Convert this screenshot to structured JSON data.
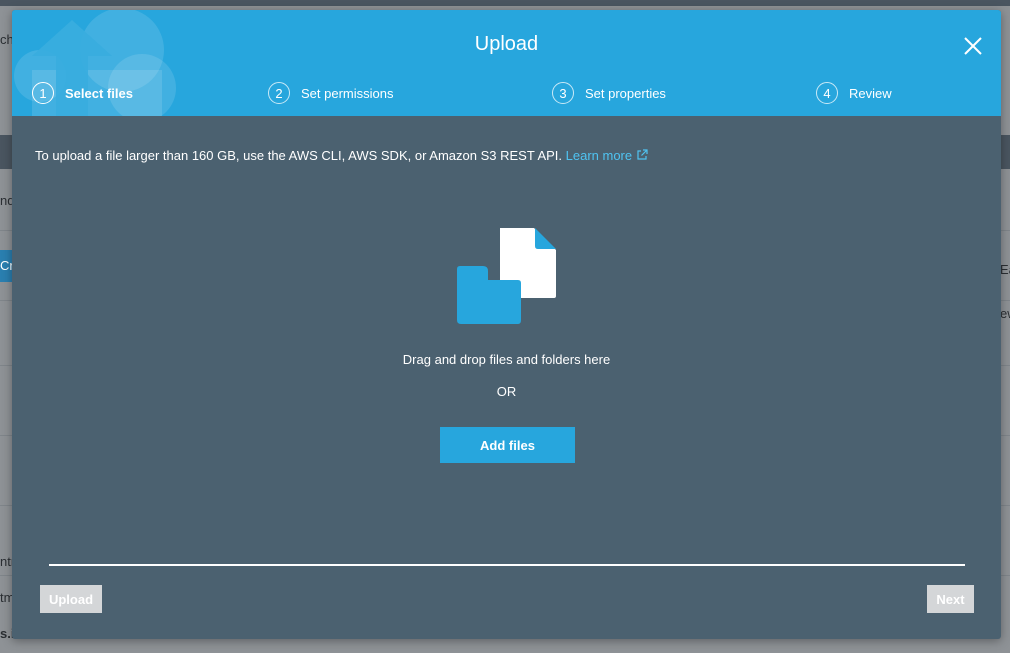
{
  "background": {
    "fragments": [
      "ch",
      "nd",
      "Cr",
      "Ea",
      "ew",
      "ntr",
      "tm",
      "s.i"
    ]
  },
  "modal": {
    "title": "Upload",
    "close_icon": "close-icon",
    "steps": [
      {
        "number": "1",
        "label": "Select files",
        "active": true
      },
      {
        "number": "2",
        "label": "Set permissions",
        "active": false
      },
      {
        "number": "3",
        "label": "Set properties",
        "active": false
      },
      {
        "number": "4",
        "label": "Review",
        "active": false
      }
    ],
    "info_text": "To upload a file larger than 160 GB, use the AWS CLI, AWS SDK, or Amazon S3 REST API.",
    "learn_more": "Learn more",
    "drop_text": "Drag and drop files and folders here",
    "or_text": "OR",
    "add_files_label": "Add files",
    "upload_label": "Upload",
    "next_label": "Next"
  },
  "colors": {
    "header": "#27a6dd",
    "body": "#4b6170",
    "accent": "#27a6dd",
    "link": "#4fc3f1",
    "disabled_button": "#d4d6d8"
  }
}
